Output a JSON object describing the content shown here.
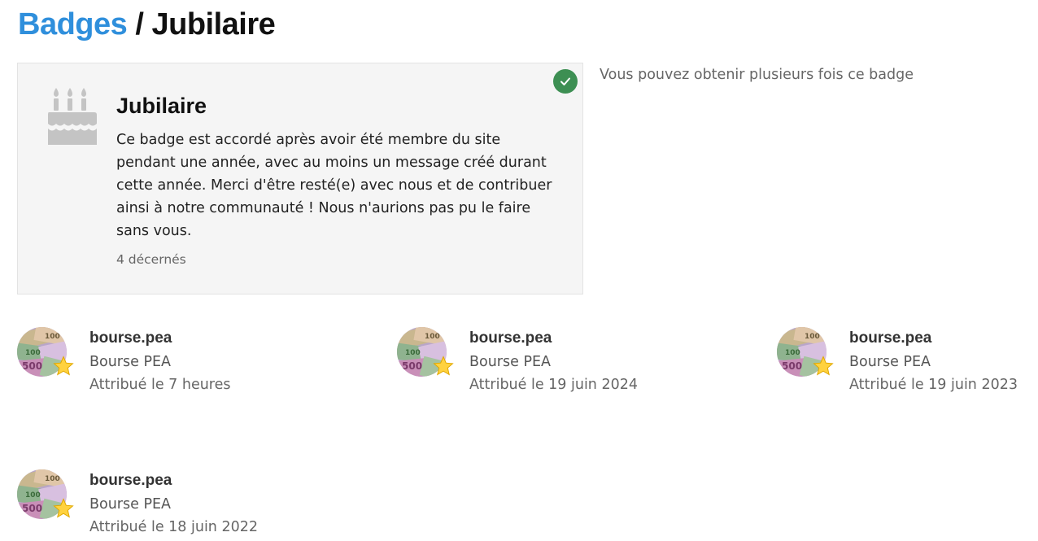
{
  "breadcrumb": {
    "parent": "Badges",
    "separator": "/",
    "current": "Jubilaire"
  },
  "badge": {
    "name": "Jubilaire",
    "icon": "birthday-cake-icon",
    "earned": true,
    "earned_icon": "check-icon",
    "description": "Ce badge est accordé après avoir été membre du site pendant une année, avec au moins un message créé durant cette année. Merci d'être resté(e) avec nous et de contribuer ainsi à notre communauté ! Nous n'aurions pas pu le faire sans vous.",
    "granted_count": "4 décernés",
    "multiple_note": "Vous pouvez obtenir plusieurs fois ce badge"
  },
  "grantees": [
    {
      "username": "bourse.pea",
      "name": "Bourse PEA",
      "granted": "Attribué le 7 heures"
    },
    {
      "username": "bourse.pea",
      "name": "Bourse PEA",
      "granted": "Attribué le 19 juin 2024"
    },
    {
      "username": "bourse.pea",
      "name": "Bourse PEA",
      "granted": "Attribué le 19 juin 2023"
    },
    {
      "username": "bourse.pea",
      "name": "Bourse PEA",
      "granted": "Attribué le 18 juin 2022"
    }
  ],
  "colors": {
    "link": "#2f8fdc",
    "check": "#3d8f53",
    "card_bg": "#f5f5f5",
    "cake_icon": "#c4c4c4"
  }
}
